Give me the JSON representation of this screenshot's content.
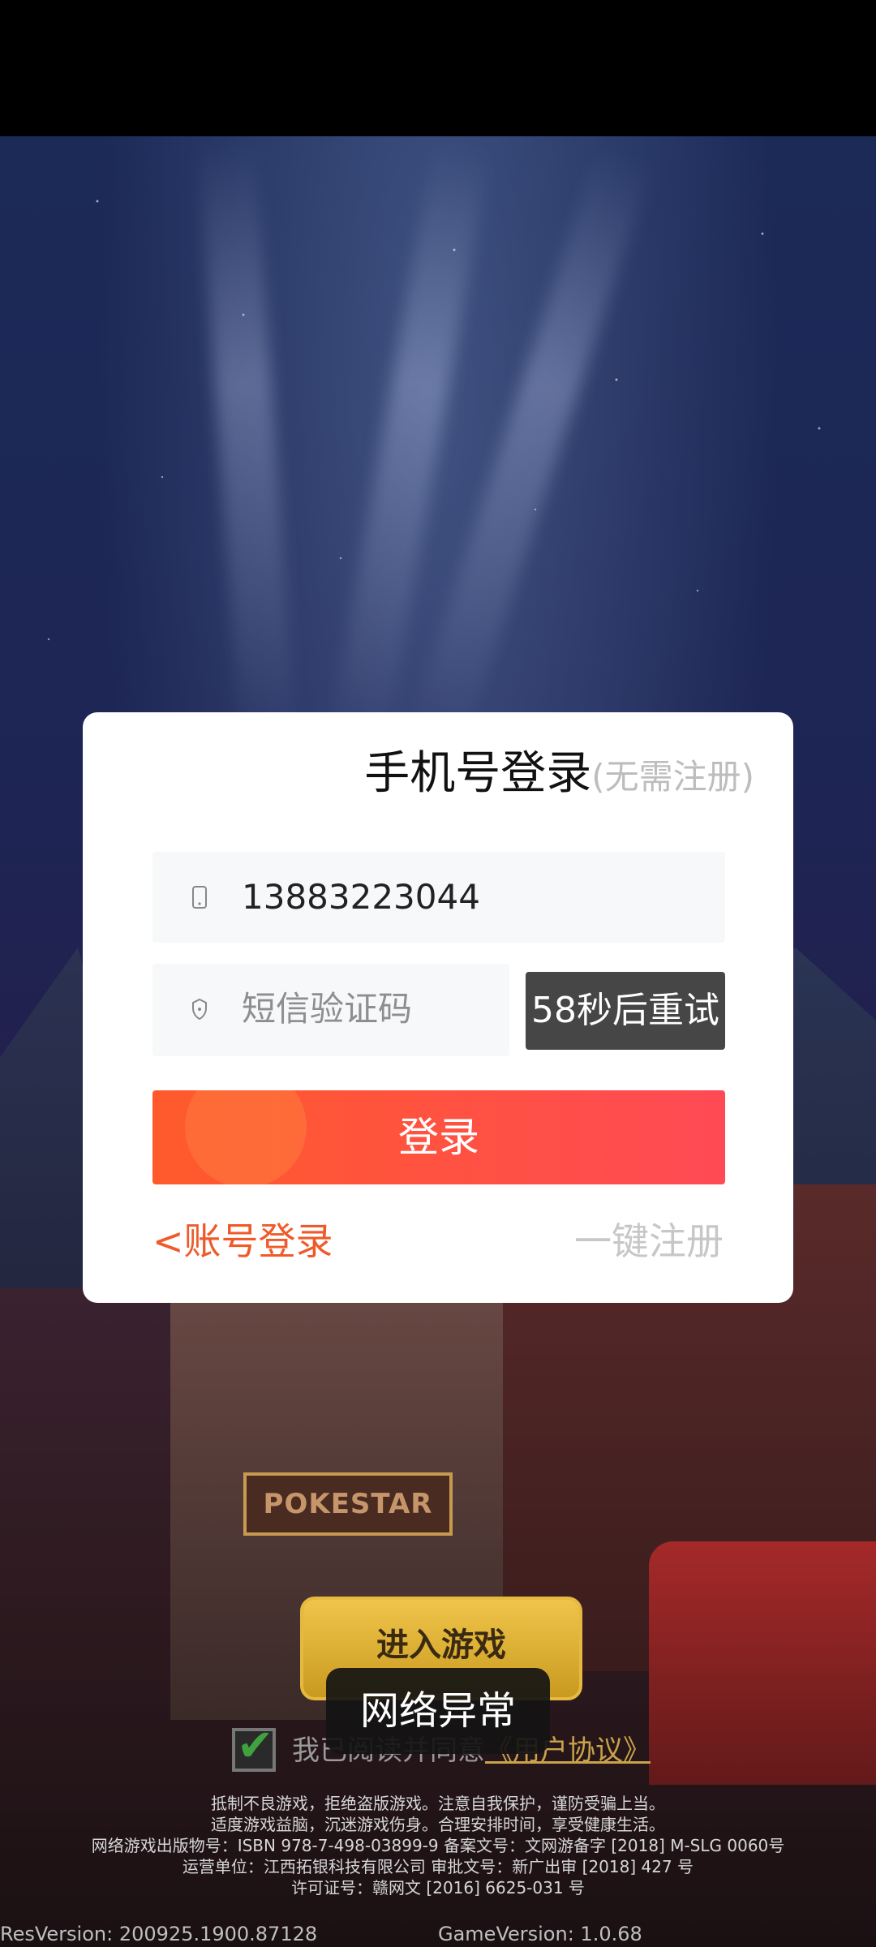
{
  "dialog": {
    "title": "手机号登录",
    "subtitle": "(无需注册)",
    "phone_value": "13883223044",
    "code_placeholder": "短信验证码",
    "retry_label": "58秒后重试",
    "login_label": "登录",
    "account_login_label": "<账号登录",
    "register_label": "一键注册"
  },
  "game": {
    "sign_text": "POKESTAR",
    "enter_button_label": "进入游戏",
    "toast_text": "网络异常",
    "agreement_prefix": "我已阅读并同意",
    "agreement_link": "《用户协议》"
  },
  "notices": {
    "line1": "抵制不良游戏，拒绝盗版游戏。注意自我保护，谨防受骗上当。",
    "line2": "适度游戏益脑，沉迷游戏伤身。合理安排时间，享受健康生活。",
    "line3": "网络游戏出版物号：ISBN 978-7-498-03899-9 备案文号：文网游备字 [2018] M-SLG 0060号",
    "line4": "运营单位：江西拓银科技有限公司 审批文号：新广出审 [2018] 427 号",
    "line5": "许可证号：赣网文 [2016] 6625-031 号"
  },
  "footer": {
    "res_version": "ResVersion: 200925.1900.87128",
    "game_version": "GameVersion: 1.0.68"
  },
  "icons": {
    "phone": "phone-icon",
    "shield": "shield-icon",
    "check": "checkmark-icon"
  },
  "colors": {
    "login_gradient_start": "#ff5a2c",
    "login_gradient_end": "#ff4a55",
    "retry_bg": "#464646",
    "link_orange": "#f05a2a",
    "muted": "#c7c7c7"
  }
}
